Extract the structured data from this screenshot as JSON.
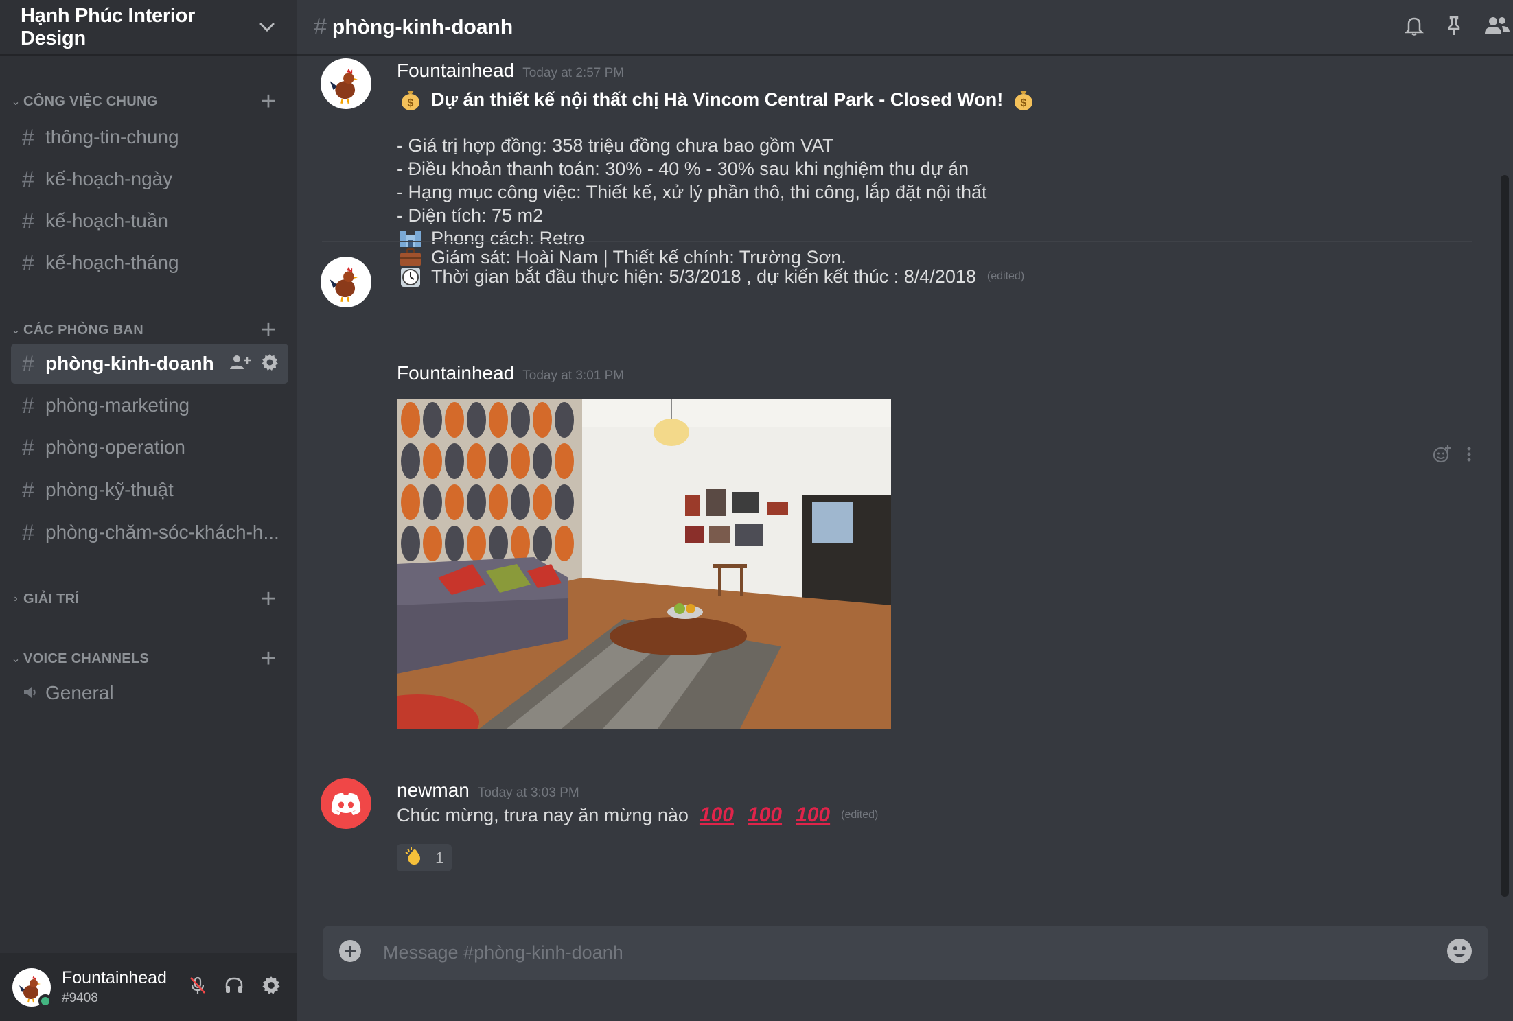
{
  "server": {
    "name": "Hạnh Phúc Interior Design"
  },
  "categories": {
    "general": {
      "label": "CÔNG VIỆC CHUNG",
      "arrow": "⌄",
      "add": "+"
    },
    "departments": {
      "label": "CÁC PHÒNG BAN",
      "arrow": "⌄",
      "add": "+"
    },
    "entertainment": {
      "label": "GIẢI TRÍ",
      "arrow": "›",
      "add": "+"
    },
    "voice": {
      "label": "VOICE CHANNELS",
      "arrow": "⌄",
      "add": "+"
    }
  },
  "channels": {
    "general": [
      {
        "label": "thông-tin-chung"
      },
      {
        "label": "kế-hoạch-ngày"
      },
      {
        "label": "kế-hoạch-tuần"
      },
      {
        "label": "kế-hoạch-tháng"
      }
    ],
    "departments": [
      {
        "label": "phòng-kinh-doanh",
        "active": true
      },
      {
        "label": "phòng-marketing"
      },
      {
        "label": "phòng-operation"
      },
      {
        "label": "phòng-kỹ-thuật"
      },
      {
        "label": "phòng-chăm-sóc-khách-h..."
      }
    ],
    "voice": [
      {
        "label": "General"
      }
    ]
  },
  "hash_symbol": "#",
  "user": {
    "name": "Fountainhead",
    "tag": "#9408",
    "status_color": "#43b581"
  },
  "header": {
    "channel_name": "phòng-kinh-doanh",
    "icons": [
      "bell-icon",
      "pin-icon",
      "members-icon"
    ]
  },
  "messages": [
    {
      "author": "Fountainhead",
      "time": "Today at 2:57 PM",
      "title": "Dự án thiết kế nội thất chị Hà Vincom Central Park - Closed Won!",
      "lines": [
        "- Giá trị hợp đồng: 358 triệu đồng chưa bao gồm VAT",
        "- Điều khoản thanh toán: 30% - 40 % - 30% sau khi nghiệm thu dự án",
        "- Hạng mục công việc: Thiết kế, xử lý phần thô, thi công, lắp đặt nội thất",
        "- Diện tích: 75 m2"
      ],
      "emoji_lines": [
        {
          "icon": "castle-emoji",
          "text": "Phong cách: Retro"
        },
        {
          "icon": "briefcase-emoji",
          "text": "Giám sát: Hoài Nam | Thiết kế chính: Trường Sơn."
        },
        {
          "icon": "clock-emoji",
          "text": "Thời gian bắt đầu thực hiện: 5/3/2018 , dự kiến kết thúc : 8/4/2018"
        }
      ],
      "edited": "(edited)"
    },
    {
      "author": "Fountainhead",
      "time": "Today at 3:01 PM",
      "image": "living-room-photo"
    },
    {
      "author": "newman",
      "time": "Today at 3:03 PM",
      "text": "Chúc mừng, trưa nay ăn mừng nào",
      "hundreds": [
        "100",
        "100",
        "100"
      ],
      "edited": "(edited)",
      "reaction": {
        "icon": "clap-emoji",
        "count": "1"
      }
    }
  ],
  "composer": {
    "placeholder": "Message #phòng-kinh-doanh"
  },
  "colors": {
    "background": "#36393f",
    "sidebar": "#2f3136",
    "user_panel": "#292b2f",
    "discord_red": "#f04747",
    "hundred_red": "#e0244a"
  }
}
